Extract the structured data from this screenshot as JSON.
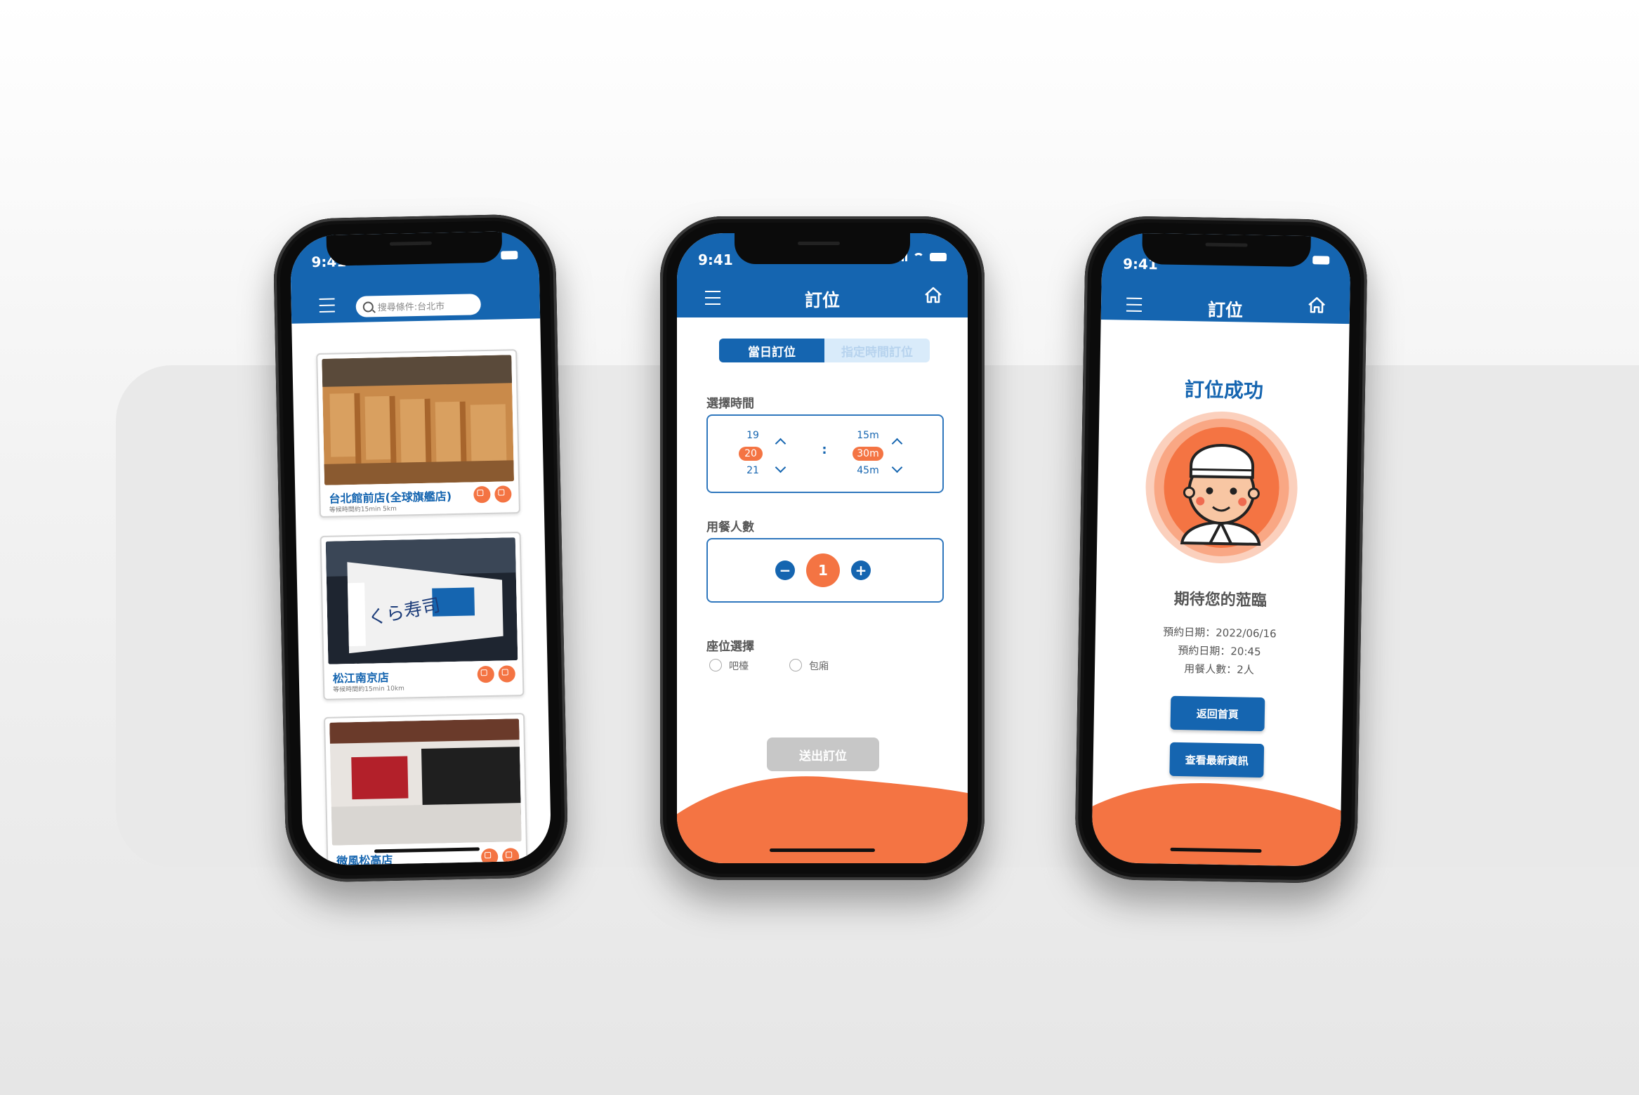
{
  "status_time": "9:41",
  "screen1": {
    "search_placeholder": "搜尋條件:台北市",
    "stores": [
      {
        "name": "台北館前店(全球旗艦店)",
        "info": "等候時間約15min    5km"
      },
      {
        "name": "松江南京店",
        "info": "等候時間約15min    10km"
      },
      {
        "name": "微風松高店",
        "info": ""
      }
    ]
  },
  "screen2": {
    "title": "訂位",
    "tabs": [
      "當日訂位",
      "指定時間訂位"
    ],
    "time_label": "選擇時間",
    "hours": [
      "19",
      "20",
      "21"
    ],
    "minutes": [
      "15m",
      "30m",
      "45m"
    ],
    "separator": ":",
    "people_label": "用餐人數",
    "people_count": "1",
    "seat_label": "座位選擇",
    "seat_options": [
      "吧檯",
      "包廂"
    ],
    "submit_label": "送出訂位"
  },
  "screen3": {
    "title": "訂位",
    "success_title": "訂位成功",
    "message": "期待您的蒞臨",
    "details": [
      "預約日期：2022/06/16",
      "預約日期：20:45",
      "用餐人數：2人"
    ],
    "back_button": "返回首頁",
    "news_button": "查看最新資訊"
  },
  "colors": {
    "brand_blue": "#1565b0",
    "accent_orange": "#f47443",
    "disabled_gray": "#c7c7c7"
  },
  "icons": [
    "menu-icon",
    "search-icon",
    "home-icon",
    "calendar-icon",
    "phone-icon",
    "chevron-up-icon",
    "chevron-down-icon",
    "minus-icon",
    "plus-icon"
  ]
}
